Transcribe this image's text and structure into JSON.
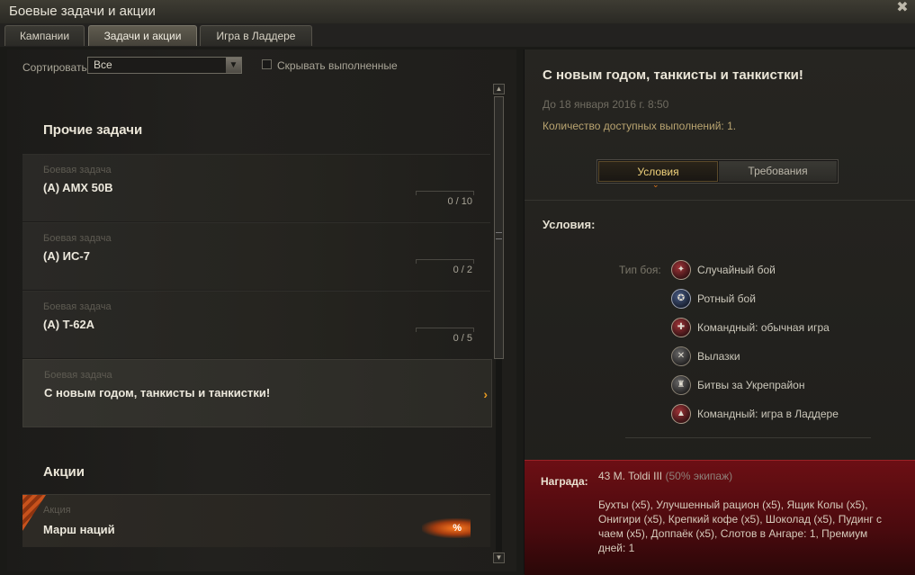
{
  "window": {
    "title": "Боевые задачи и акции",
    "close_glyph": "✖"
  },
  "tabs": [
    {
      "label": "Кампании",
      "active": false
    },
    {
      "label": "Задачи и акции",
      "active": true
    },
    {
      "label": "Игра в Ладдере",
      "active": false
    }
  ],
  "filter": {
    "sort_label": "Сортировать:",
    "sort_value": "Все",
    "hide_completed_label": "Скрывать выполненные"
  },
  "sections": {
    "other_tasks_title": "Прочие задачи",
    "actions_title": "Акции"
  },
  "quests": [
    {
      "type": "Боевая задача",
      "name": "(A) AMX 50B",
      "progress": "0 / 10",
      "selected": false
    },
    {
      "type": "Боевая задача",
      "name": "(A) ИС-7",
      "progress": "0 / 2",
      "selected": false
    },
    {
      "type": "Боевая задача",
      "name": "(A) T-62A",
      "progress": "0 / 5",
      "selected": false
    },
    {
      "type": "Боевая задача",
      "name": "С новым годом, танкисты и танкистки!",
      "arrow": "›",
      "selected": true
    }
  ],
  "action": {
    "type": "Акция",
    "name": "Марш наций",
    "badge": "%"
  },
  "detail": {
    "title": "С новым годом, танкисты и танкистки!",
    "date": "До 18 января 2016 г. 8:50",
    "count": "Количество доступных выполнений: 1.",
    "subtabs": [
      "Условия",
      "Требования"
    ],
    "conditions_title": "Условия:",
    "battle_type_label": "Тип боя:",
    "battle_types": [
      {
        "label": "Случайный бой",
        "icon": "random-battle-icon"
      },
      {
        "label": "Ротный бой",
        "icon": "company-battle-icon"
      },
      {
        "label": "Командный: обычная игра",
        "icon": "team-battle-icon"
      },
      {
        "label": "Вылазки",
        "icon": "skirmish-icon"
      },
      {
        "label": "Битвы за Укрепрайон",
        "icon": "stronghold-battle-icon"
      },
      {
        "label": "Командный: игра в Ладдере",
        "icon": "ladder-battle-icon"
      }
    ],
    "reward": {
      "label": "Награда:",
      "tank": "43 M. Toldi III",
      "tank_note": "(50% экипаж)",
      "items": "Бухты (x5), Улучшенный рацион (x5), Ящик Колы (x5), Онигири (x5), Крепкий кофе (x5), Шоколад (x5), Пудинг с чаем (x5), Доппаёк (x5), Слотов в Ангаре: 1, Премиум дней: 1"
    }
  },
  "colors": {
    "accent_orange": "#e79a22",
    "reward_red": "#6c0f14",
    "gold_text": "#f0d27b"
  }
}
